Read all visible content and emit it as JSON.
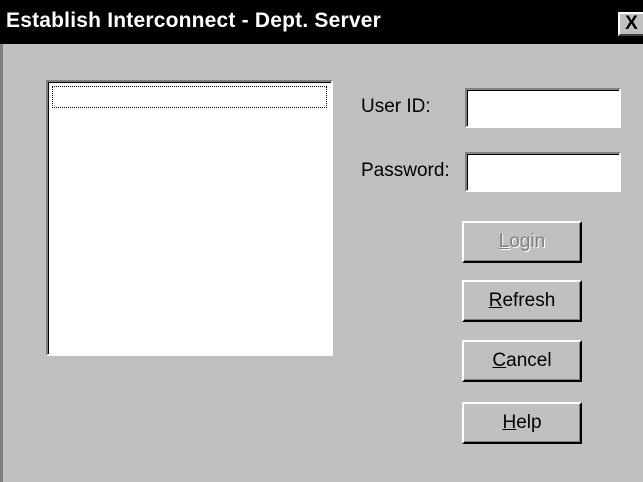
{
  "window": {
    "title": "Establish Interconnect - Dept. Server",
    "close_label": "X"
  },
  "form": {
    "userid_label": "User ID:",
    "userid_value": "",
    "password_label": "Password:",
    "password_value": ""
  },
  "buttons": {
    "login": {
      "mnemonic": "L",
      "rest": "ogin",
      "enabled": false
    },
    "refresh": {
      "mnemonic": "R",
      "rest": "efresh",
      "enabled": true
    },
    "cancel": {
      "mnemonic": "C",
      "rest": "ancel",
      "enabled": true
    },
    "help": {
      "mnemonic": "H",
      "rest": "elp",
      "enabled": true
    }
  },
  "server_list": {
    "items": []
  },
  "colors": {
    "face": "#c0c0c0",
    "titlebar": "#000000",
    "disabled_text": "#808080"
  }
}
